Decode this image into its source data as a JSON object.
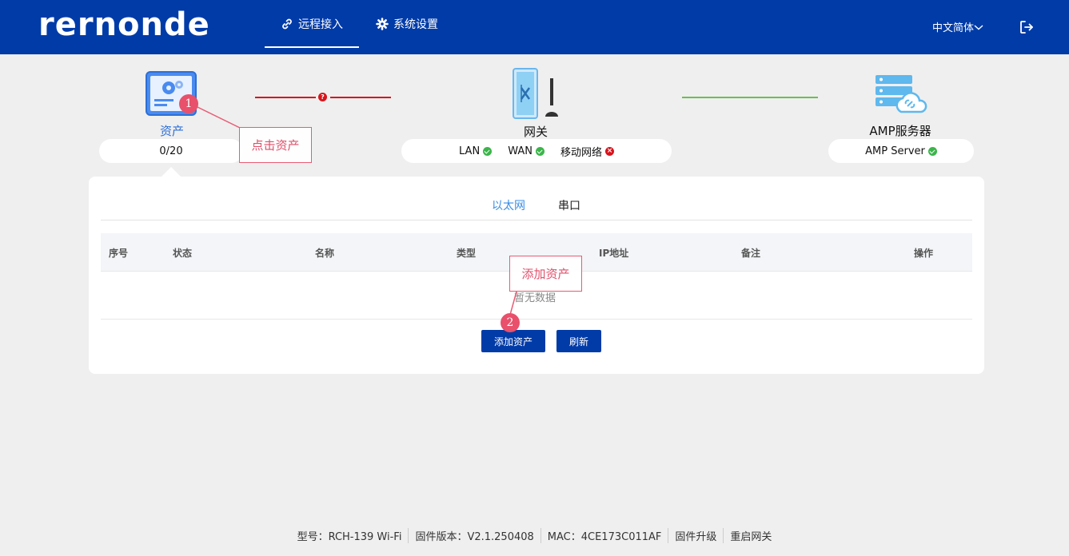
{
  "header": {
    "logo": "rernonde",
    "tabs": [
      {
        "label": "远程接入",
        "icon": "link-icon"
      },
      {
        "label": "系统设置",
        "icon": "gear-icon"
      }
    ],
    "language": "中文简体",
    "brand_color": "#003ba8"
  },
  "topology": {
    "asset": {
      "label": "资产",
      "count": "0/20"
    },
    "gateway": {
      "label": "网关",
      "status": [
        {
          "label": "LAN",
          "state": "ok"
        },
        {
          "label": "WAN",
          "state": "ok"
        },
        {
          "label": "移动网络",
          "state": "error"
        }
      ]
    },
    "server": {
      "label": "AMP服务器",
      "status_label": "AMP Server",
      "state": "ok"
    },
    "colors": {
      "ok": "#3bb54a",
      "error": "#d8141c",
      "link_ok": "#6ac14b"
    }
  },
  "panel": {
    "tabs": [
      "以太网",
      "串口"
    ],
    "columns": [
      "序号",
      "状态",
      "名称",
      "类型",
      "IP地址",
      "备注",
      "操作"
    ],
    "empty_text": "暂无数据",
    "buttons": {
      "add": "添加资产",
      "refresh": "刷新"
    }
  },
  "annotations": [
    {
      "number": "1",
      "text": "点击资产"
    },
    {
      "number": "2",
      "text": "添加资产"
    }
  ],
  "footer": {
    "model": "型号：RCH-139  Wi-Fi",
    "firmware": "固件版本：V2.1.250408",
    "mac": "MAC：4CE173C011AF",
    "upgrade": "固件升级",
    "reboot": "重启网关"
  }
}
